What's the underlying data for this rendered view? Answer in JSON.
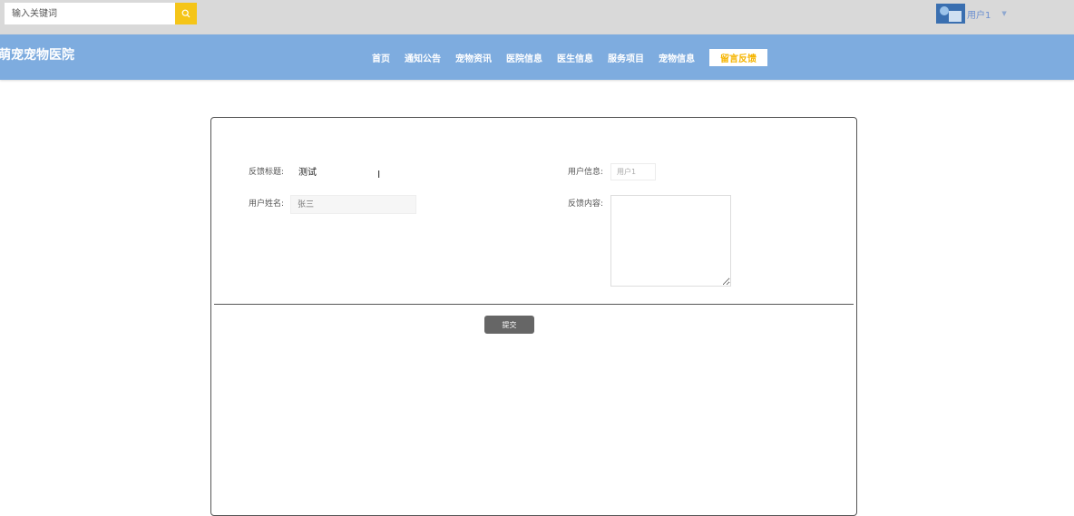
{
  "search": {
    "placeholder": "输入关键词"
  },
  "user": {
    "name": "用户1"
  },
  "brand": {
    "title": "萌宠宠物医院"
  },
  "nav": {
    "items": [
      {
        "label": "首页"
      },
      {
        "label": "通知公告"
      },
      {
        "label": "宠物资讯"
      },
      {
        "label": "医院信息"
      },
      {
        "label": "医生信息"
      },
      {
        "label": "服务项目"
      },
      {
        "label": "宠物信息"
      },
      {
        "label": "留言反馈"
      }
    ]
  },
  "form": {
    "title_label": "反馈标题:",
    "title_value": "测试",
    "user_info_label": "用户信息:",
    "user_info_value": "用户1",
    "name_label": "用户姓名:",
    "name_placeholder": "张三",
    "content_label": "反馈内容:",
    "content_value": "",
    "submit_label": "提交"
  },
  "colors": {
    "nav_bg": "#7eacdf",
    "accent": "#f5c518",
    "active_text": "#f5b400"
  }
}
